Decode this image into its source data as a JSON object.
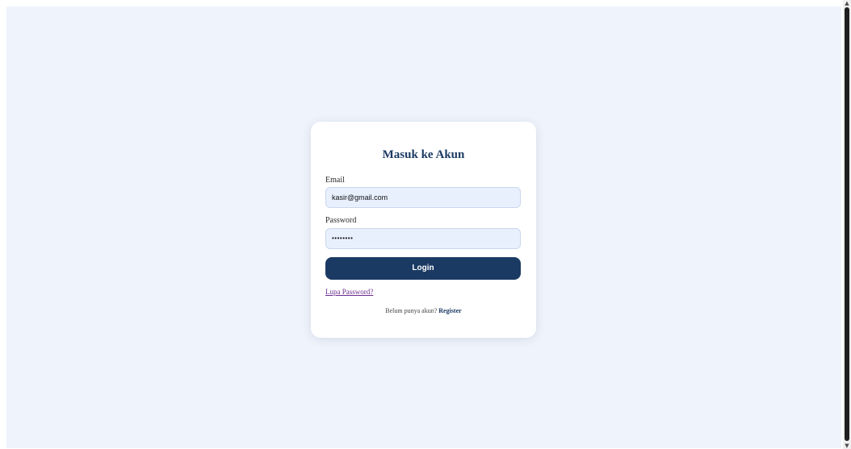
{
  "login": {
    "title": "Masuk ke Akun",
    "email_label": "Email",
    "email_value": "kasir@gmail.com",
    "password_label": "Password",
    "password_value": "••••••••",
    "login_button": "Login",
    "forgot_password": "Lupa Password?",
    "no_account_text": "Belum punya akun?",
    "register_link": "Register"
  },
  "colors": {
    "page_background": "#eff3fb",
    "card_background": "#ffffff",
    "primary": "#1b3a63",
    "input_background": "#e8f0fe",
    "link_visited": "#6a2c8f"
  }
}
